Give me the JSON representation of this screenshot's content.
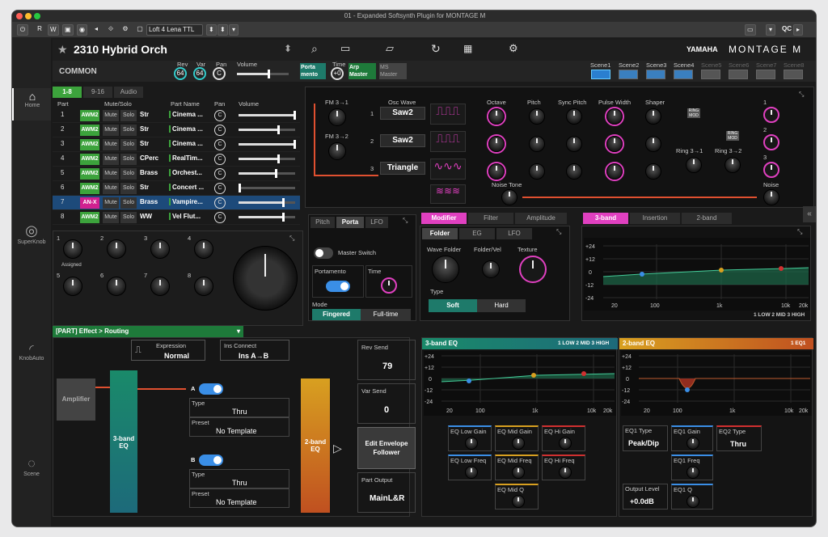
{
  "window": {
    "title": "01 - Expanded Softsynth Plugin for MONTAGE M"
  },
  "toolbar": {
    "r": "R",
    "w": "W",
    "preset": "Loft 4 Lena TTL",
    "qc": "QC"
  },
  "header": {
    "program": "2310 Hybrid Orch",
    "brand": "YAMAHA",
    "product": "MONTAGE M"
  },
  "sidebar": {
    "home": "Home",
    "superknob": "SuperKnob",
    "knobauto": "KnobAuto",
    "scene": "Scene"
  },
  "common": {
    "title": "COMMON",
    "rev_label": "Rev",
    "rev": "64",
    "var_label": "Var",
    "var": "64",
    "pan_label": "Pan",
    "pan": "C",
    "vol_label": "Volume",
    "porta": "Porta\nmento",
    "time_label": "Time",
    "time": "+0",
    "arp": "Arp\nMaster",
    "ms": "MS\nMaster"
  },
  "scenes": [
    "Scene1",
    "Scene2",
    "Scene3",
    "Scene4",
    "Scene5",
    "Scene6",
    "Scene7",
    "Scene8"
  ],
  "part_tabs": [
    "1-8",
    "9-16",
    "Audio"
  ],
  "part_cols": {
    "part": "Part",
    "mute_solo": "Mute/Solo",
    "name": "Part Name",
    "pan": "Pan",
    "volume": "Volume"
  },
  "parts": [
    {
      "n": "1",
      "eng": "AWM2",
      "cat": "Str",
      "name": "Cinema ...",
      "pan": "C",
      "vol": 0.98
    },
    {
      "n": "2",
      "eng": "AWM2",
      "cat": "Str",
      "name": "Cinema ...",
      "pan": "C",
      "vol": 0.7
    },
    {
      "n": "3",
      "eng": "AWM2",
      "cat": "Str",
      "name": "Cinema ...",
      "pan": "C",
      "vol": 0.98
    },
    {
      "n": "4",
      "eng": "AWM2",
      "cat": "CPerc",
      "name": "RealTim...",
      "pan": "C",
      "vol": 0.7
    },
    {
      "n": "5",
      "eng": "AWM2",
      "cat": "Brass",
      "name": "Orchest...",
      "pan": "C",
      "vol": 0.65
    },
    {
      "n": "6",
      "eng": "AWM2",
      "cat": "Str",
      "name": "Concert ...",
      "pan": "C",
      "vol": 0.02
    },
    {
      "n": "7",
      "eng": "AN-X",
      "cat": "Brass",
      "name": "Vampire...",
      "pan": "C",
      "vol": 0.78
    },
    {
      "n": "8",
      "eng": "AWM2",
      "cat": "WW",
      "name": "Vel Flut...",
      "pan": "C",
      "vol": 0.78
    }
  ],
  "mute": "Mute",
  "solo": "Solo",
  "knobs": {
    "labels": [
      "1",
      "2",
      "3",
      "4",
      "5",
      "6",
      "7",
      "8"
    ],
    "assigned": "Assigned"
  },
  "osc": {
    "fm31": "FM 3→1",
    "fm32": "FM 3→2",
    "osc_wave": "Osc Wave",
    "waves": [
      "Saw2",
      "Saw2",
      "Triangle"
    ],
    "nums": [
      "1",
      "2",
      "3"
    ],
    "cols": [
      "Octave",
      "Pitch",
      "Sync Pitch",
      "Pulse Width",
      "Shaper"
    ],
    "ring31": "Ring 3→1",
    "ring32": "Ring 3→2",
    "noise_tone": "Noise Tone",
    "noise": "Noise",
    "out1": "1",
    "out2": "2",
    "out3": "3",
    "ring_mod": "RING\nMOD"
  },
  "porta": {
    "tabs": [
      "Pitch",
      "Porta",
      "LFO"
    ],
    "master_switch": "Master Switch",
    "portamento": "Portamento",
    "time": "Time",
    "mode": "Mode",
    "fingered": "Fingered",
    "fulltime": "Full-time"
  },
  "modifier": {
    "tabs": [
      "Modifier",
      "Filter",
      "Amplitude"
    ],
    "sub": [
      "Folder",
      "EG",
      "LFO"
    ],
    "wave_folder": "Wave Folder",
    "folder_vel": "Folder/Vel",
    "texture": "Texture",
    "type": "Type",
    "soft": "Soft",
    "hard": "Hard"
  },
  "eq3top": {
    "tabs": [
      "3-band",
      "Insertion",
      "2-band"
    ],
    "legend": "1 LOW 2 MID 3 HIGH"
  },
  "routing": {
    "title": "[PART] Effect > Routing",
    "expression": "Expression",
    "normal": "Normal",
    "ins_connect": "Ins Connect",
    "ins_ab": "Ins A→B",
    "amplifier": "Amplifier",
    "eq3": "3-band\nEQ",
    "a": "A",
    "b": "B",
    "type": "Type",
    "thru": "Thru",
    "preset": "Preset",
    "no_template": "No Template",
    "eq2": "2-band\nEQ",
    "rev_send": "Rev Send",
    "rev_val": "79",
    "var_send": "Var Send",
    "var_val": "0",
    "edit_env": "Edit Envelope\nFollower",
    "part_output": "Part Output",
    "output_val": "MainL&R"
  },
  "eq3": {
    "title": "3-band EQ",
    "legend": "1 LOW 2 MID 3 HIGH",
    "yticks": [
      "+24",
      "+12",
      "0",
      "-12",
      "-24"
    ],
    "xticks": [
      "20",
      "100",
      "1k",
      "10k",
      "20k"
    ],
    "params": [
      "EQ Low Gain",
      "EQ Mid Gain",
      "EQ Hi Gain",
      "EQ Low Freq",
      "EQ Mid Freq",
      "EQ Hi Freq",
      "EQ Mid Q"
    ]
  },
  "eq2": {
    "title": "2-band EQ",
    "legend": "1 EQ1",
    "eq1type": "EQ1 Type",
    "eq1type_val": "Peak/Dip",
    "eq1gain": "EQ1 Gain",
    "eq2type": "EQ2 Type",
    "eq2type_val": "Thru",
    "eq1freq": "EQ1 Freq",
    "output_level": "Output Level",
    "output_val": "+0.0dB",
    "eq1q": "EQ1 Q"
  }
}
